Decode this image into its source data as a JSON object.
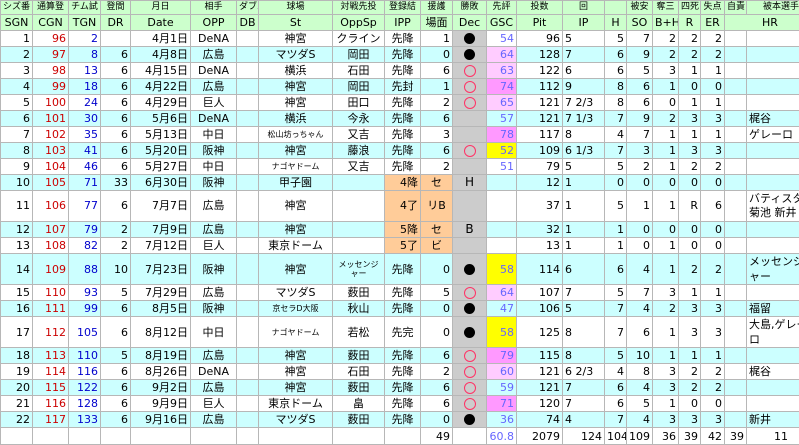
{
  "header_top": [
    "シズ番",
    "通算登",
    "チム試",
    "登間",
    "月日",
    "相手",
    "ダブル",
    "球場",
    "対戦先投",
    "登録結",
    "援護",
    "勝敗",
    "先評",
    "投数",
    "回",
    "",
    "被安",
    "奪三",
    "四死",
    "失点",
    "自責",
    "被本選手"
  ],
  "header": [
    "SGN",
    "CGN",
    "TGN",
    "DR",
    "Date",
    "OPP",
    "DB",
    "St",
    "OppSp",
    "IPP",
    "場面",
    "Dec",
    "GSC",
    "Pit",
    "IP",
    "H",
    "SO",
    "B+H",
    "R",
    "ER",
    "HR"
  ],
  "rows": [
    {
      "sgn": "1",
      "cgn": "96",
      "tgn": "2",
      "dr": "",
      "date": "4月1日",
      "opp": "DeNA",
      "db": "",
      "st": "神宮",
      "oppsp": "クライン",
      "ipp": "先降",
      "ba": "1",
      "dec": "●",
      "gsc": "54",
      "pit": "96",
      "ip": "5",
      "h": "5",
      "so": "7",
      "bh": "2",
      "r": "2",
      "er": "2",
      "hr": ""
    },
    {
      "sgn": "2",
      "cgn": "97",
      "tgn": "8",
      "dr": "6",
      "date": "4月8日",
      "opp": "広島",
      "db": "",
      "st": "マツダS",
      "oppsp": "岡田",
      "ipp": "先降",
      "ba": "0",
      "dec": "●",
      "gsc": "64",
      "pit": "128",
      "ip": "7",
      "h": "6",
      "so": "9",
      "bh": "2",
      "r": "2",
      "er": "2",
      "hr": ""
    },
    {
      "sgn": "3",
      "cgn": "98",
      "tgn": "13",
      "dr": "6",
      "date": "4月15日",
      "opp": "DeNA",
      "db": "",
      "st": "横浜",
      "oppsp": "石田",
      "ipp": "先降",
      "ba": "6",
      "dec": "○",
      "gsc": "63",
      "pit": "122",
      "ip": "6",
      "h": "6",
      "so": "5",
      "bh": "3",
      "r": "1",
      "er": "1",
      "hr": ""
    },
    {
      "sgn": "4",
      "cgn": "99",
      "tgn": "18",
      "dr": "6",
      "date": "4月22日",
      "opp": "広島",
      "db": "",
      "st": "神宮",
      "oppsp": "岡田",
      "ipp": "先封",
      "ba": "1",
      "dec": "○",
      "gsc": "74",
      "pit": "112",
      "ip": "9",
      "h": "8",
      "so": "6",
      "bh": "1",
      "r": "0",
      "er": "0",
      "hr": ""
    },
    {
      "sgn": "5",
      "cgn": "100",
      "tgn": "24",
      "dr": "6",
      "date": "4月29日",
      "opp": "巨人",
      "db": "",
      "st": "神宮",
      "oppsp": "田口",
      "ipp": "先降",
      "ba": "2",
      "dec": "○",
      "gsc": "65",
      "pit": "121",
      "ip": "7 2/3",
      "h": "8",
      "so": "6",
      "bh": "0",
      "r": "1",
      "er": "1",
      "hr": ""
    },
    {
      "sgn": "6",
      "cgn": "101",
      "tgn": "30",
      "dr": "6",
      "date": "5月6日",
      "opp": "DeNA",
      "db": "",
      "st": "横浜",
      "oppsp": "今永",
      "ipp": "先降",
      "ba": "6",
      "dec": "",
      "gsc": "57",
      "pit": "121",
      "ip": "7 1/3",
      "h": "7",
      "so": "9",
      "bh": "2",
      "r": "3",
      "er": "3",
      "hr": "梶谷"
    },
    {
      "sgn": "7",
      "cgn": "102",
      "tgn": "35",
      "dr": "6",
      "date": "5月13日",
      "opp": "中日",
      "db": "",
      "st": "松山坊っちゃん",
      "oppsp": "又吉",
      "ipp": "先降",
      "ba": "3",
      "dec": "",
      "gsc": "78",
      "pit": "117",
      "ip": "8",
      "h": "4",
      "so": "7",
      "bh": "1",
      "r": "1",
      "er": "1",
      "hr": "ゲレーロ"
    },
    {
      "sgn": "8",
      "cgn": "103",
      "tgn": "41",
      "dr": "6",
      "date": "5月20日",
      "opp": "阪神",
      "db": "",
      "st": "神宮",
      "oppsp": "藤浪",
      "ipp": "先降",
      "ba": "6",
      "dec": "○",
      "gsc": "52",
      "pit": "109",
      "ip": "6 1/3",
      "h": "7",
      "so": "3",
      "bh": "1",
      "r": "3",
      "er": "3",
      "hr": ""
    },
    {
      "sgn": "9",
      "cgn": "104",
      "tgn": "46",
      "dr": "6",
      "date": "5月27日",
      "opp": "中日",
      "db": "",
      "st": "ナゴヤドーム",
      "oppsp": "又吉",
      "ipp": "先降",
      "ba": "2",
      "dec": "",
      "gsc": "51",
      "pit": "79",
      "ip": "5",
      "h": "5",
      "so": "2",
      "bh": "1",
      "r": "2",
      "er": "2",
      "hr": ""
    },
    {
      "sgn": "10",
      "cgn": "105",
      "tgn": "71",
      "dr": "33",
      "date": "6月30日",
      "opp": "阪神",
      "db": "",
      "st": "甲子園",
      "oppsp": "",
      "ipp": "4降",
      "ba": "セ",
      "dec": "H",
      "gsc": "",
      "pit": "12",
      "ip": "1",
      "h": "0",
      "so": "0",
      "bh": "0",
      "r": "0",
      "er": "0",
      "hr": ""
    },
    {
      "sgn": "11",
      "cgn": "106",
      "tgn": "77",
      "dr": "6",
      "date": "7月7日",
      "opp": "広島",
      "db": "",
      "st": "神宮",
      "oppsp": "",
      "ipp": "4了",
      "ba": "リB",
      "dec": "",
      "gsc": "",
      "pit": "37",
      "ip": "1",
      "h": "5",
      "so": "1",
      "bh": "1",
      "r": "R",
      "er": "6",
      "hr": "バティスタ,菊池 新井"
    },
    {
      "sgn": "12",
      "cgn": "107",
      "tgn": "79",
      "dr": "2",
      "date": "7月9日",
      "opp": "広島",
      "db": "",
      "st": "神宮",
      "oppsp": "",
      "ipp": "5降",
      "ba": "セ",
      "dec": "B",
      "gsc": "",
      "pit": "32",
      "ip": "1",
      "h": "1",
      "so": "0",
      "bh": "0",
      "r": "0",
      "er": "0",
      "hr": ""
    },
    {
      "sgn": "13",
      "cgn": "108",
      "tgn": "82",
      "dr": "2",
      "date": "7月12日",
      "opp": "巨人",
      "db": "",
      "st": "東京ドーム",
      "oppsp": "",
      "ipp": "5了",
      "ba": "ビ",
      "dec": "",
      "gsc": "",
      "pit": "13",
      "ip": "1",
      "h": "1",
      "so": "0",
      "bh": "1",
      "r": "0",
      "er": "0",
      "hr": ""
    },
    {
      "sgn": "14",
      "cgn": "109",
      "tgn": "88",
      "dr": "10",
      "date": "7月23日",
      "opp": "阪神",
      "db": "",
      "st": "神宮",
      "oppsp": "メッセンジャー",
      "ipp": "先降",
      "ba": "0",
      "dec": "●",
      "gsc": "58",
      "pit": "114",
      "ip": "6",
      "h": "6",
      "so": "4",
      "bh": "1",
      "r": "2",
      "er": "2",
      "hr": "メッセンジャー"
    },
    {
      "sgn": "15",
      "cgn": "110",
      "tgn": "93",
      "dr": "5",
      "date": "7月29日",
      "opp": "広島",
      "db": "",
      "st": "マツダS",
      "oppsp": "薮田",
      "ipp": "先降",
      "ba": "5",
      "dec": "○",
      "gsc": "64",
      "pit": "107",
      "ip": "7",
      "h": "5",
      "so": "7",
      "bh": "3",
      "r": "1",
      "er": "1",
      "hr": ""
    },
    {
      "sgn": "16",
      "cgn": "111",
      "tgn": "99",
      "dr": "6",
      "date": "8月5日",
      "opp": "阪神",
      "db": "",
      "st": "京セラD大阪",
      "oppsp": "秋山",
      "ipp": "先降",
      "ba": "0",
      "dec": "●",
      "gsc": "47",
      "pit": "106",
      "ip": "5",
      "h": "7",
      "so": "4",
      "bh": "2",
      "r": "3",
      "er": "3",
      "hr": "福留"
    },
    {
      "sgn": "17",
      "cgn": "112",
      "tgn": "105",
      "dr": "6",
      "date": "8月12日",
      "opp": "中日",
      "db": "",
      "st": "ナゴヤドーム",
      "oppsp": "若松",
      "ipp": "先完",
      "ba": "0",
      "dec": "●",
      "gsc": "58",
      "pit": "125",
      "ip": "8",
      "h": "7",
      "so": "6",
      "bh": "1",
      "r": "3",
      "er": "3",
      "hr": "大島,ゲレーロ"
    },
    {
      "sgn": "18",
      "cgn": "113",
      "tgn": "110",
      "dr": "5",
      "date": "8月19日",
      "opp": "広島",
      "db": "",
      "st": "神宮",
      "oppsp": "薮田",
      "ipp": "先降",
      "ba": "6",
      "dec": "○",
      "gsc": "79",
      "pit": "115",
      "ip": "8",
      "h": "5",
      "so": "10",
      "bh": "1",
      "r": "1",
      "er": "1",
      "hr": ""
    },
    {
      "sgn": "19",
      "cgn": "114",
      "tgn": "116",
      "dr": "6",
      "date": "8月26日",
      "opp": "DeNA",
      "db": "",
      "st": "神宮",
      "oppsp": "石田",
      "ipp": "先降",
      "ba": "2",
      "dec": "○",
      "gsc": "60",
      "pit": "121",
      "ip": "6 2/3",
      "h": "4",
      "so": "8",
      "bh": "3",
      "r": "2",
      "er": "2",
      "hr": "梶谷"
    },
    {
      "sgn": "20",
      "cgn": "115",
      "tgn": "122",
      "dr": "6",
      "date": "9月2日",
      "opp": "広島",
      "db": "",
      "st": "神宮",
      "oppsp": "薮田",
      "ipp": "先降",
      "ba": "6",
      "dec": "○",
      "gsc": "59",
      "pit": "121",
      "ip": "7",
      "h": "6",
      "so": "4",
      "bh": "3",
      "r": "2",
      "er": "2",
      "hr": ""
    },
    {
      "sgn": "21",
      "cgn": "116",
      "tgn": "128",
      "dr": "6",
      "date": "9月9日",
      "opp": "巨人",
      "db": "",
      "st": "東京ドーム",
      "oppsp": "畠",
      "ipp": "先降",
      "ba": "6",
      "dec": "○",
      "gsc": "71",
      "pit": "120",
      "ip": "7",
      "h": "6",
      "so": "5",
      "bh": "1",
      "r": "0",
      "er": "0",
      "hr": ""
    },
    {
      "sgn": "22",
      "cgn": "117",
      "tgn": "133",
      "dr": "6",
      "date": "9月16日",
      "opp": "広島",
      "db": "",
      "st": "マツダS",
      "oppsp": "薮田",
      "ipp": "先降",
      "ba": "0",
      "dec": "●",
      "gsc": "36",
      "pit": "74",
      "ip": "4",
      "h": "7",
      "so": "4",
      "bh": "3",
      "r": "3",
      "er": "3",
      "hr": "新井"
    }
  ],
  "totals": {
    "ba": "49",
    "gsc": "60.8",
    "pit": "2079",
    "ip": "124",
    "h": "104",
    "so": "109",
    "bh": "36",
    "r": "39",
    "er": "42",
    "er2": "39",
    "hr": "11"
  },
  "colors": {
    "header_bg": "#ccffcc",
    "row_shade": "#ccffff",
    "red": "#cc0000",
    "blue": "#0000cc",
    "gsc_high": "#ffff00",
    "gsc_mid": "#ff99ff",
    "orange": "#ffcc99",
    "dec_bg": "#cccccc"
  }
}
